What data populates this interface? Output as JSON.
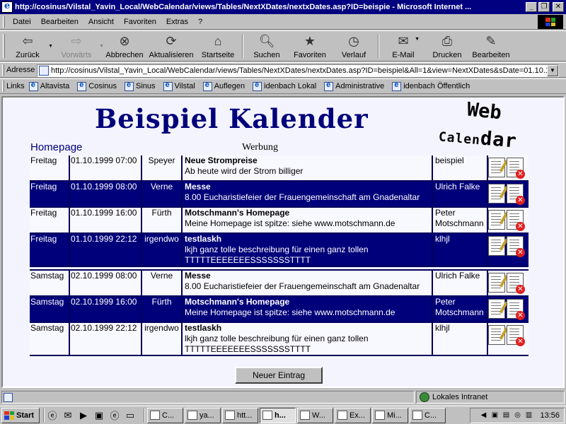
{
  "window": {
    "title": "http://cosinus/Vilstal_Yavin_Local/WebCalendar/views/Tables/NextXDates/nextxDates.asp?ID=beispie - Microsoft Internet ...",
    "minimize": "_",
    "maximize": "❐",
    "close": "✕"
  },
  "menu": [
    "Datei",
    "Bearbeiten",
    "Ansicht",
    "Favoriten",
    "Extras",
    "?"
  ],
  "toolbar": {
    "back": "Zurück",
    "forward": "Vorwärts",
    "stop": "Abbrechen",
    "refresh": "Aktualisieren",
    "home": "Startseite",
    "search": "Suchen",
    "favorites": "Favoriten",
    "history": "Verlauf",
    "mail": "E-Mail",
    "print": "Drucken",
    "edit": "Bearbeiten"
  },
  "address": {
    "label": "Adresse",
    "url": "http://cosinus/Vilstal_Yavin_Local/WebCalendar/views/Tables/NextXDates/nextxDates.asp?ID=beispiel&All=1&view=NextXDates&sDate=01.10.1"
  },
  "links": {
    "label": "Links",
    "items": [
      "Altavista",
      "Cosinus",
      "Sinus",
      "Vilstal",
      "Auflegen",
      "idenbach Lokal",
      "Administrative",
      "idenbach Öffentlich"
    ]
  },
  "page": {
    "title": "Beispiel Kalender",
    "logo_web": "Web",
    "logo_cal_a": "Calen",
    "logo_cal_b": "dar",
    "homepage": "Homepage",
    "werbung": "Werbung",
    "new_entry": "Neuer Eintrag"
  },
  "entries": [
    {
      "day": "Freitag",
      "datetime": "01.10.1999 07:00",
      "location": "Speyer",
      "title": "Neue Strompreise",
      "text": "Ab heute wird der Strom billiger",
      "owner": "beispiel",
      "style": "light"
    },
    {
      "day": "Freitag",
      "datetime": "01.10.1999 08:00",
      "location": "Verne",
      "title": "Messe",
      "text": "8.00 Eucharistiefeier der Frauengemeinschaft am Gnadenaltar",
      "owner": "Ulrich Falke",
      "style": "dark"
    },
    {
      "day": "Freitag",
      "datetime": "01.10.1999 16:00",
      "location": "Fürth",
      "title": "Motschmann's Homepage",
      "text": "Meine Homepage ist spitze: siehe www.motschmann.de",
      "owner": "Peter Motschmann",
      "style": "light"
    },
    {
      "day": "Freitag",
      "datetime": "01.10.1999 22:12",
      "location": "irgendwo",
      "title": "testlaskh",
      "text": "lkjh ganz tolle beschreibung für einen ganz tollen TTTTTEEEEEEESSSSSSSTTTT",
      "owner": "klhjl",
      "style": "dark"
    },
    {
      "day": "Samstag",
      "datetime": "02.10.1999 08:00",
      "location": "Verne",
      "title": "Messe",
      "text": "8.00 Eucharistiefeier der Frauengemeinschaft am Gnadenaltar",
      "owner": "Ulrich Falke",
      "style": "light"
    },
    {
      "day": "Samstag",
      "datetime": "02.10.1999 16:00",
      "location": "Fürth",
      "title": "Motschmann's Homepage",
      "text": "Meine Homepage ist spitze: siehe www.motschmann.de",
      "owner": "Peter Motschmann",
      "style": "dark"
    },
    {
      "day": "Samstag",
      "datetime": "02.10.1999 22:12",
      "location": "irgendwo",
      "title": "testlaskh",
      "text": "lkjh ganz tolle beschreibung für einen ganz tollen TTTTTEEEEEEESSSSSSSTTTT",
      "owner": "klhjl",
      "style": "light"
    }
  ],
  "status": {
    "zone": "Lokales Intranet"
  },
  "taskbar": {
    "start": "Start",
    "tasks": [
      "C...",
      "ya...",
      "htt...",
      "h...",
      "W...",
      "Ex...",
      "Mi...",
      "C..."
    ],
    "active_task": 3,
    "clock": "13:56"
  },
  "colors": {
    "navy": "#00007a",
    "row_dark": "#00007a",
    "row_light": "#f8f8ff"
  }
}
